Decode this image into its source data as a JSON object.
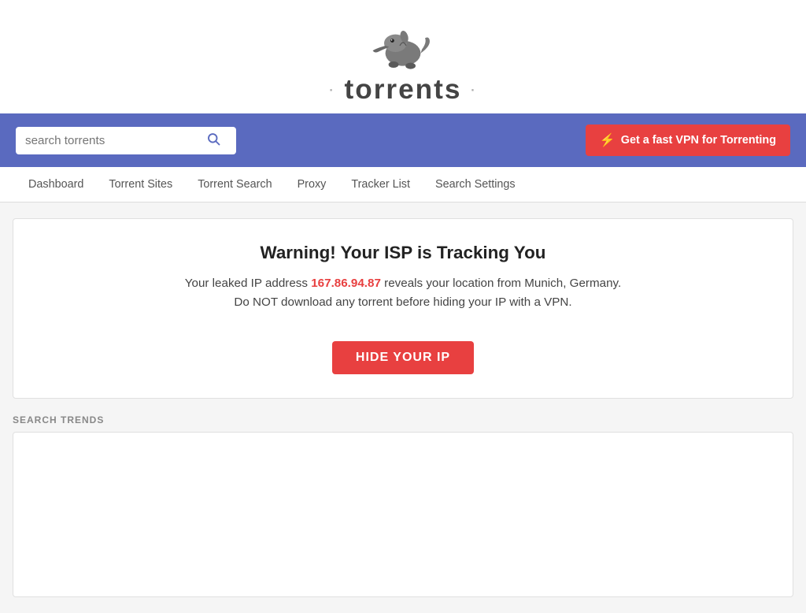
{
  "header": {
    "logo_text": "torrents",
    "logo_dots": "·"
  },
  "search": {
    "placeholder": "search torrents",
    "value": ""
  },
  "vpn_button": {
    "label": "Get a fast VPN for Torrenting",
    "bolt": "⚡"
  },
  "nav": {
    "items": [
      {
        "label": "Dashboard",
        "href": "#"
      },
      {
        "label": "Torrent Sites",
        "href": "#"
      },
      {
        "label": "Torrent Search",
        "href": "#"
      },
      {
        "label": "Proxy",
        "href": "#"
      },
      {
        "label": "Tracker List",
        "href": "#"
      },
      {
        "label": "Search Settings",
        "href": "#"
      }
    ]
  },
  "warning": {
    "title": "Warning! Your ISP is Tracking You",
    "line1_prefix": "Your leaked IP address",
    "ip": "167.86.94.87",
    "line1_suffix": "reveals your location from Munich, Germany.",
    "line2": "Do NOT download any torrent before hiding your IP with a VPN.",
    "button": "HIDE YOUR IP"
  },
  "trends": {
    "label": "SEARCH TRENDS"
  }
}
